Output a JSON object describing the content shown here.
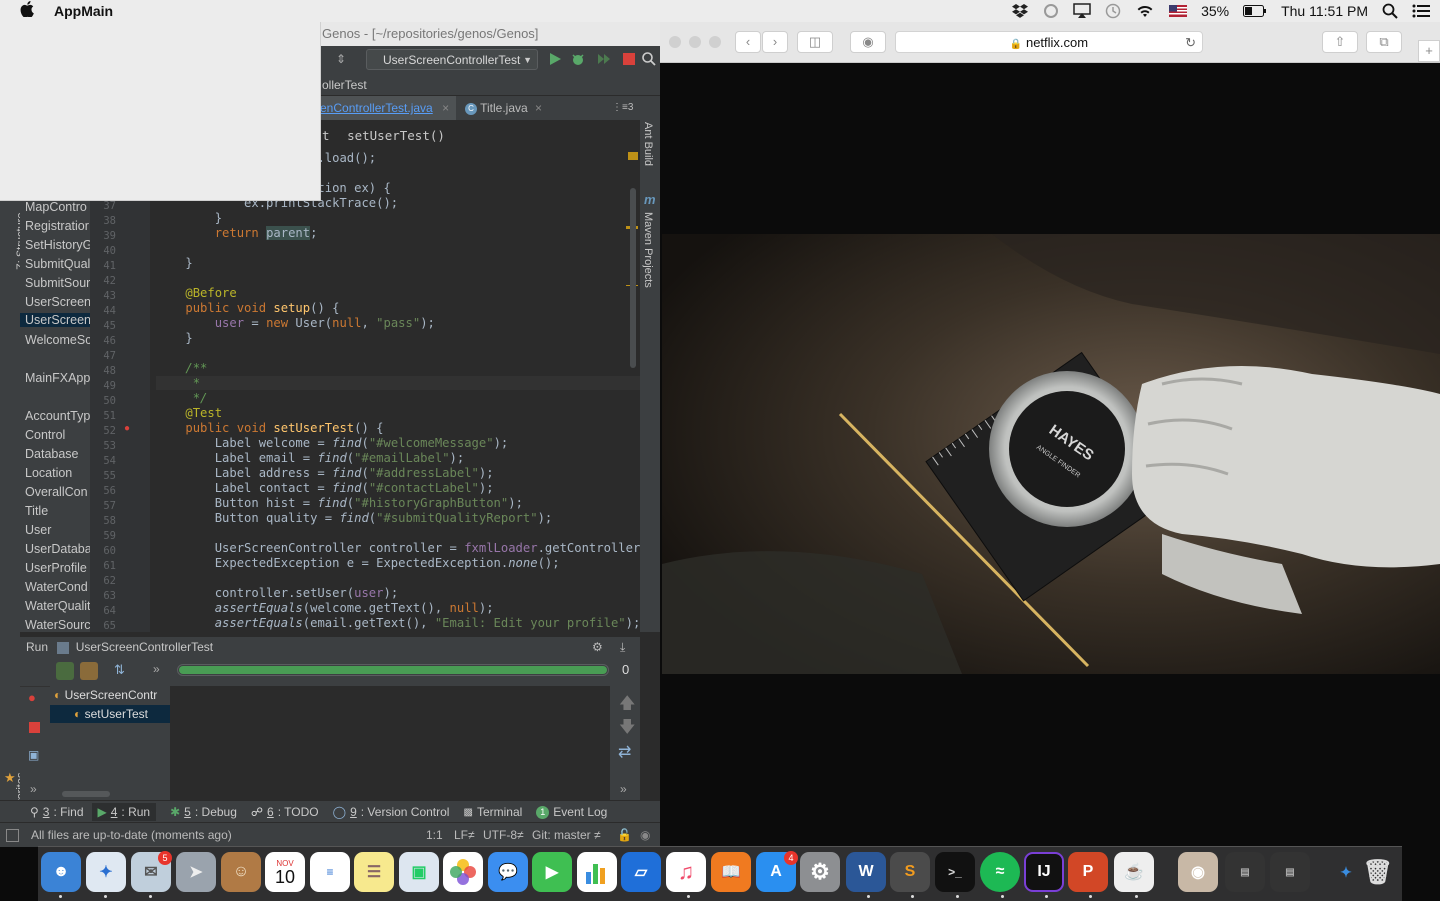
{
  "menubar": {
    "app_name": "AppMain",
    "battery": "35%",
    "clock": "Thu 11:51 PM"
  },
  "ide": {
    "window_title": "Genos - [~/repositories/genos/Genos]",
    "run_config": "UserScreenControllerTest",
    "breadcrumb": "ollerTest",
    "tabs": [
      {
        "label": "enControllerTest.java",
        "active": true
      },
      {
        "label": "Title.java",
        "active": false
      }
    ],
    "tab_overflow": "⋮≡3",
    "method_crumb_prefix": "t",
    "method_crumb": "setUserTest()",
    "side_tool_left": [
      "Z: Structure",
      "2: Favorites"
    ],
    "side_tool_right": [
      "Ant Build",
      "Maven Projects"
    ],
    "project_items": [
      "MapContro",
      "Registratior",
      "SetHistoryG",
      "SubmitQual",
      "SubmitSour",
      "UserScreen",
      "UserScreen",
      "WelcomeSc",
      "",
      "MainFXApp",
      "",
      "AccountTyp",
      "Control",
      "Database",
      "Location",
      "OverallCon",
      "Title",
      "User",
      "UserDataba",
      "UserProfile",
      "WaterCond",
      "WaterQualit",
      "WaterSourc"
    ],
    "line_numbers": [
      "37",
      "38",
      "39",
      "40",
      "41",
      "42",
      "43",
      "44",
      "45",
      "46",
      "47",
      "48",
      "49",
      "50",
      "51",
      "52",
      "53",
      "54",
      "55",
      "56",
      "57",
      "58",
      "59",
      "60",
      "61",
      "62",
      "63",
      "64",
      "65"
    ]
  },
  "run_panel": {
    "label": "Run",
    "config": "UserScreenControllerTest",
    "progress_count": "0",
    "progress_fraction": 1.0,
    "tree_root": "UserScreenContr",
    "tree_child": "setUserTest"
  },
  "bottom_tabs": [
    {
      "num": "3",
      "label": ": Find"
    },
    {
      "num": "4",
      "label": ": Run"
    },
    {
      "num": "5",
      "label": ": Debug"
    },
    {
      "num": "6",
      "label": ": TODO"
    },
    {
      "num": "9",
      "label": ": Version Control"
    },
    {
      "num": "",
      "label": "Terminal"
    },
    {
      "num": "",
      "label": "Event Log"
    }
  ],
  "status": {
    "message": "All files are up-to-date (moments ago)",
    "position": "1:1",
    "line_sep": "LF≠",
    "encoding": "UTF-8≠",
    "git": "Git: master ≠"
  },
  "browser": {
    "url": "netflix.com",
    "video_brand": "HAYES",
    "video_label": "ANGLE FINDER"
  },
  "dock": {
    "calendar_month": "NOV",
    "calendar_day": "10",
    "mail_badge": "5",
    "appstore_badge": "4"
  },
  "colors": {
    "ide_bg": "#2b2b2b",
    "keyword": "#cc7832",
    "annotation": "#bbb529",
    "string": "#6a8759",
    "field": "#9876aa",
    "progress": "#499c54"
  }
}
